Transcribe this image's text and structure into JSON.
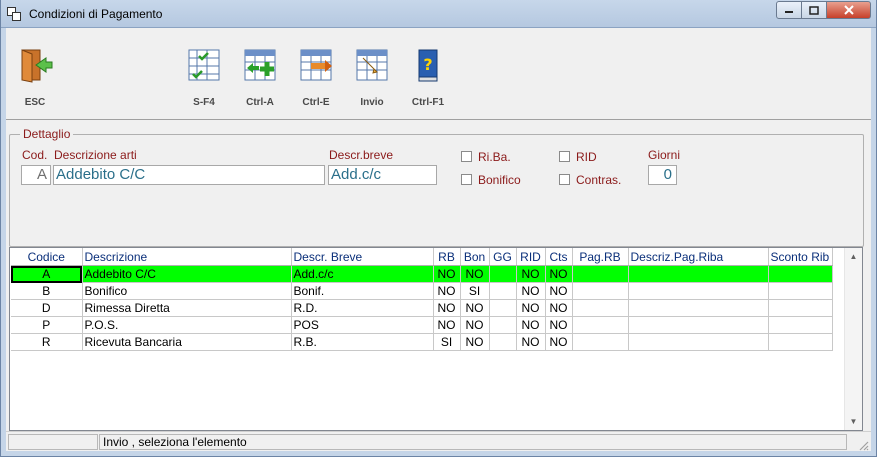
{
  "window": {
    "title": "Condizioni di Pagamento",
    "icon": "window-app-icon"
  },
  "toolbar": {
    "esc_label": "ESC",
    "buttons": [
      {
        "label": "S-F4",
        "icon": "grid-check-icon"
      },
      {
        "label": "Ctrl-A",
        "icon": "grid-add-icon"
      },
      {
        "label": "Ctrl-E",
        "icon": "grid-edit-icon"
      },
      {
        "label": "Invio",
        "icon": "grid-pencil-icon"
      },
      {
        "label": "Ctrl-F1",
        "icon": "help-book-icon"
      }
    ]
  },
  "detail": {
    "legend": "Dettaglio",
    "cod_label": "Cod.",
    "cod_value": "A",
    "descr_label": "Descrizione arti",
    "descr_value": "Addebito C/C",
    "breve_label": "Descr.breve",
    "breve_value": "Add.c/c",
    "riba_label": "Ri.Ba.",
    "bonifico_label": "Bonifico",
    "rid_label": "RID",
    "contras_label": "Contras.",
    "giorni_label": "Giorni",
    "giorni_value": "0"
  },
  "grid": {
    "headers": [
      "Codice",
      "Descrizione",
      "Descr. Breve",
      "RB",
      "Bon",
      "GG",
      "RID",
      "Cts",
      "Pag.RB",
      "Descriz.Pag.Riba",
      "Sconto Rib"
    ],
    "rows": [
      [
        "A",
        "Addebito C/C",
        "Add.c/c",
        "NO",
        "NO",
        "",
        "NO",
        "NO",
        "",
        "",
        ""
      ],
      [
        "B",
        "Bonifico",
        "Bonif.",
        "NO",
        "SI",
        "",
        "NO",
        "NO",
        "",
        "",
        ""
      ],
      [
        "D",
        "Rimessa Diretta",
        "R.D.",
        "NO",
        "NO",
        "",
        "NO",
        "NO",
        "",
        "",
        ""
      ],
      [
        "P",
        "P.O.S.",
        "POS",
        "NO",
        "NO",
        "",
        "NO",
        "NO",
        "",
        "",
        ""
      ],
      [
        "R",
        "Ricevuta Bancaria",
        "R.B.",
        "SI",
        "NO",
        "",
        "NO",
        "NO",
        "",
        "",
        ""
      ]
    ],
    "selected_row": 0
  },
  "status": {
    "message": "Invio , seleziona l'elemento"
  },
  "colors": {
    "selected_row": "#00ff00",
    "label": "#8b1a1a",
    "field_text": "#2a6f8a",
    "header_text": "#0a2f7a"
  }
}
